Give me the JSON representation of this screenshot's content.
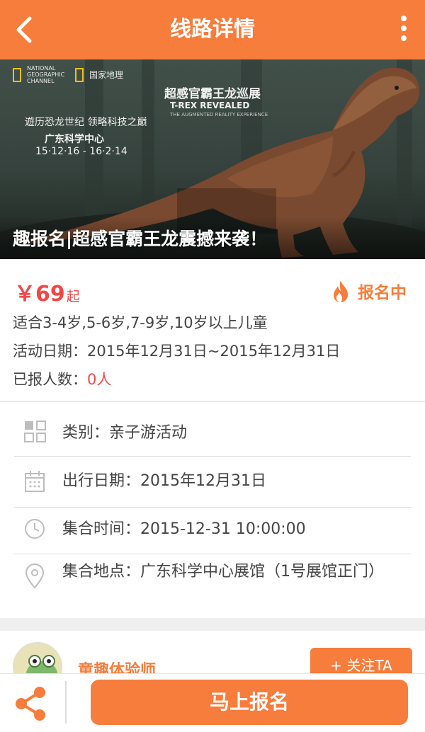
{
  "header": {
    "title": "线路详情",
    "back_icon": "chevron-left-icon",
    "more_icon": "more-vertical-icon"
  },
  "banner": {
    "brand_en": "NATIONAL GEOGRAPHIC CHANNEL",
    "brand_cn": "国家地理",
    "expo_title": "超感官霸王龙巡展",
    "expo_en": "T-REX REVEALED",
    "expo_sub": "THE AUGMENTED REALITY EXPERIENCE",
    "left_line1": "遊历恐龙世纪 领略科技之巅",
    "left_line2": "广东科学中心",
    "left_line3": "15·12·16 - 16·2·14",
    "caption": "趣报名|超感官霸王龙震撼来袭！"
  },
  "info": {
    "price": "￥69",
    "price_suffix": "起",
    "status": "报名中",
    "age_line": "适合3-4岁,5-6岁,7-9岁,10岁以上儿童",
    "date_line": "活动日期：2015年12月31日~2015年12月31日",
    "enrolled_label": "已报人数：",
    "enrolled_value": "0人"
  },
  "details": {
    "category": "类别：亲子游活动",
    "travel_date": "出行日期：2015年12月31日",
    "meet_time": "集合时间：2015-12-31 10:00:00",
    "meet_place": "集合地点：广东科学中心展馆（1号展馆正门）"
  },
  "host": {
    "name": "童趣体验师",
    "follow_label": "+ 关注TA"
  },
  "bottom": {
    "signup_label": "马上报名",
    "share_icon": "share-icon"
  },
  "colors": {
    "accent": "#f67d3c",
    "price": "#f34747"
  }
}
